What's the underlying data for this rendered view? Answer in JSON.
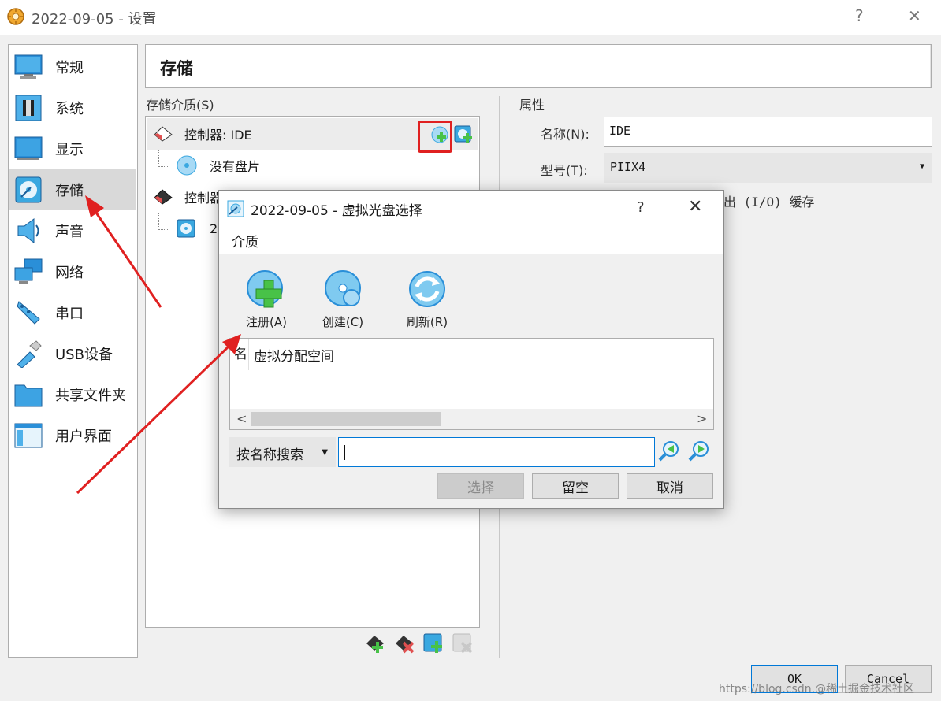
{
  "window": {
    "title": "2022-09-05 - 设置",
    "help": "?",
    "close": "✕"
  },
  "sidebar": {
    "items": [
      {
        "label": "常规",
        "icon": "monitor-icon"
      },
      {
        "label": "系统",
        "icon": "chip-icon"
      },
      {
        "label": "显示",
        "icon": "display-icon"
      },
      {
        "label": "存储",
        "icon": "disk-icon",
        "selected": true
      },
      {
        "label": "声音",
        "icon": "speaker-icon"
      },
      {
        "label": "网络",
        "icon": "network-icon"
      },
      {
        "label": "串口",
        "icon": "serial-port-icon"
      },
      {
        "label": "USB设备",
        "icon": "usb-icon"
      },
      {
        "label": "共享文件夹",
        "icon": "folder-icon"
      },
      {
        "label": "用户界面",
        "icon": "ui-window-icon"
      }
    ]
  },
  "header": {
    "title": "存储"
  },
  "storage": {
    "section_label": "存储介质(S)",
    "tree": [
      {
        "label": "控制器: IDE"
      },
      {
        "label": "没有盘片"
      },
      {
        "label": "控制器"
      },
      {
        "label": "20"
      }
    ]
  },
  "properties": {
    "section_label": "属性",
    "name_label": "名称(N):",
    "name_value": "IDE",
    "type_label": "型号(T):",
    "type_value": "PIIX4",
    "partial_text": "出 (I/O) 缓存"
  },
  "buttons": {
    "ok": "OK",
    "cancel": "Cancel"
  },
  "dialog": {
    "title": "2022-09-05 - 虚拟光盘选择",
    "help": "?",
    "close": "✕",
    "menu": "介质",
    "tools": [
      {
        "label": "注册(A)"
      },
      {
        "label": "创建(C)"
      },
      {
        "label": "刷新(R)"
      }
    ],
    "list": {
      "col1": "名",
      "col2": "虚拟分配空间"
    },
    "search_mode": "按名称搜索",
    "search_value": "",
    "buttons": {
      "choose": "选择",
      "leave_empty": "留空",
      "cancel": "取消"
    }
  },
  "watermark": "https://blog.csdn.@稀土掘金技术社区",
  "colors": {
    "accent": "#0078d7",
    "annotation": "#e02020",
    "icon_blue": "#3aa8e0",
    "icon_green": "#48c248"
  }
}
